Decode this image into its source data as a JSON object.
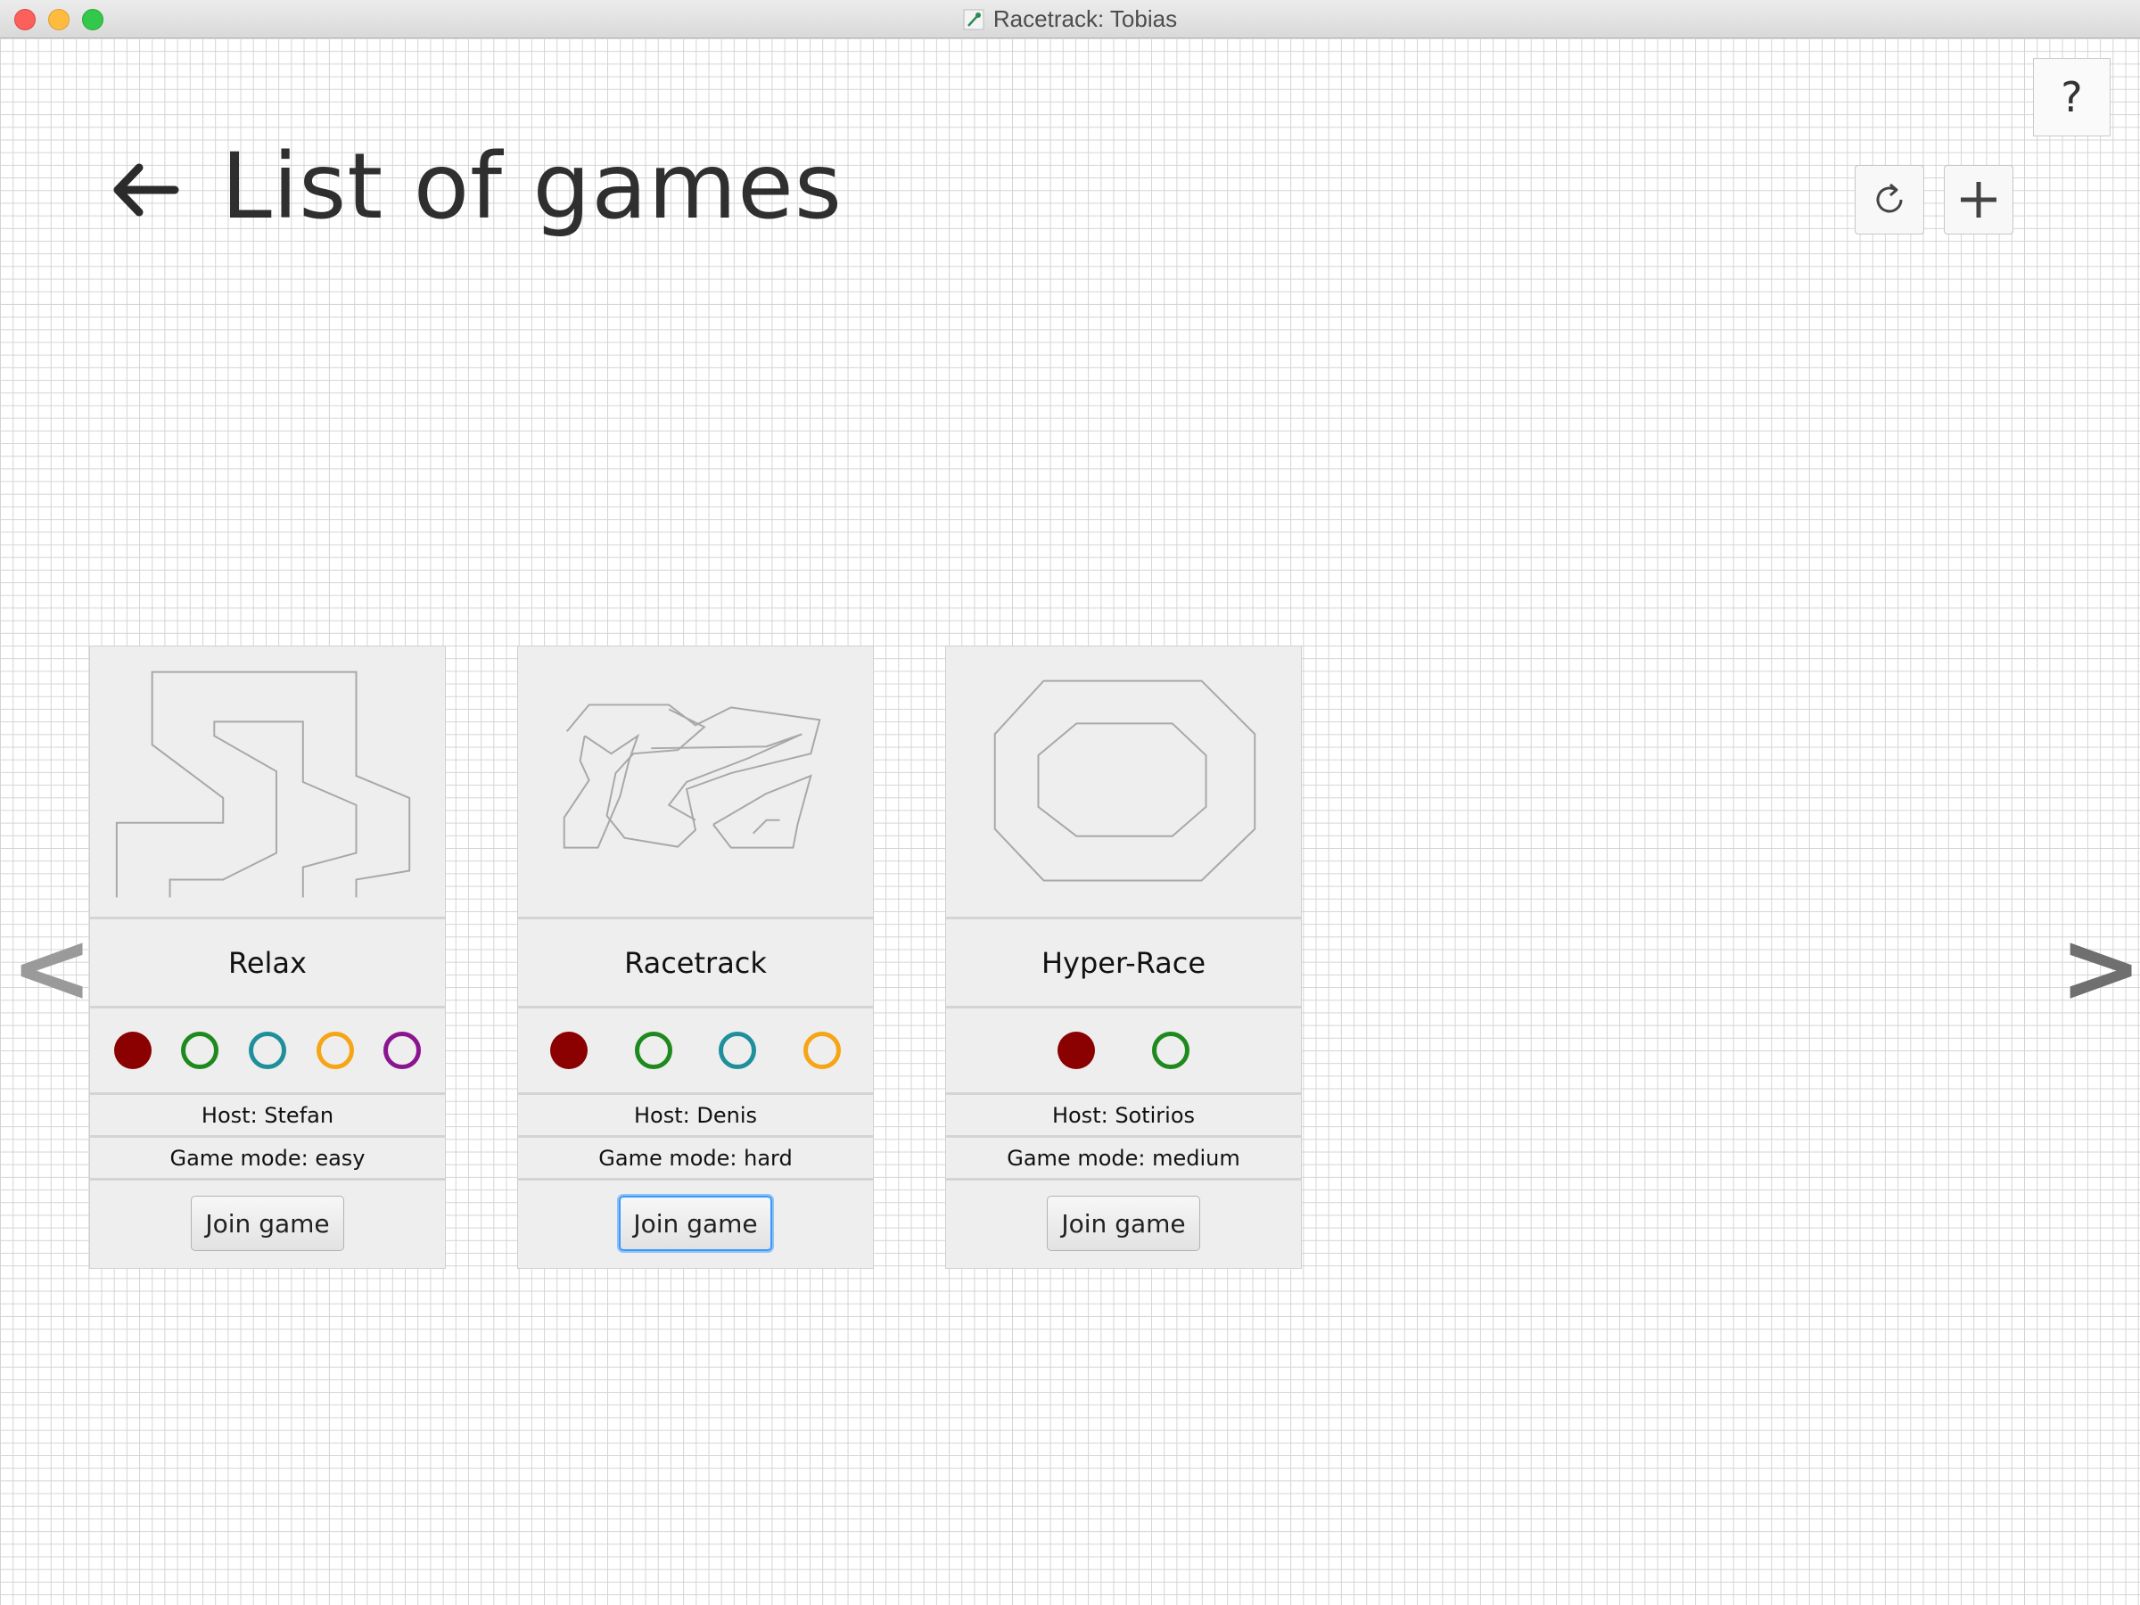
{
  "window": {
    "title": "Racetrack: Tobias"
  },
  "header": {
    "title": "List of games",
    "back_icon": "arrow-left-icon",
    "help_label": "?",
    "refresh_icon": "refresh-icon",
    "add_icon": "plus-icon"
  },
  "nav": {
    "prev_label": "<",
    "next_label": ">"
  },
  "colors": {
    "player_red": "#8b0000",
    "player_green": "#1e8a1e",
    "player_teal": "#1f8f9b",
    "player_orange": "#f5a516",
    "player_purple": "#8a1590",
    "focus_ring": "#3b99fc"
  },
  "games": [
    {
      "name": "Relax",
      "host": "Host: Stefan",
      "mode": "Game mode: easy",
      "join_label": "Join game",
      "players": [
        {
          "color": "#8b0000",
          "filled": true
        },
        {
          "color": "#1e8a1e",
          "filled": false
        },
        {
          "color": "#1f8f9b",
          "filled": false
        },
        {
          "color": "#f5a516",
          "filled": false
        },
        {
          "color": "#8a1590",
          "filled": false
        }
      ]
    },
    {
      "name": "Racetrack",
      "host": "Host: Denis",
      "mode": "Game mode: hard",
      "join_label": "Join game",
      "focused": true,
      "players": [
        {
          "color": "#8b0000",
          "filled": true
        },
        {
          "color": "#1e8a1e",
          "filled": false
        },
        {
          "color": "#1f8f9b",
          "filled": false
        },
        {
          "color": "#f5a516",
          "filled": false
        }
      ]
    },
    {
      "name": "Hyper-Race",
      "host": "Host: Sotirios",
      "mode": "Game mode: medium",
      "join_label": "Join game",
      "players": [
        {
          "color": "#8b0000",
          "filled": true
        },
        {
          "color": "#1e8a1e",
          "filled": false
        }
      ]
    }
  ]
}
